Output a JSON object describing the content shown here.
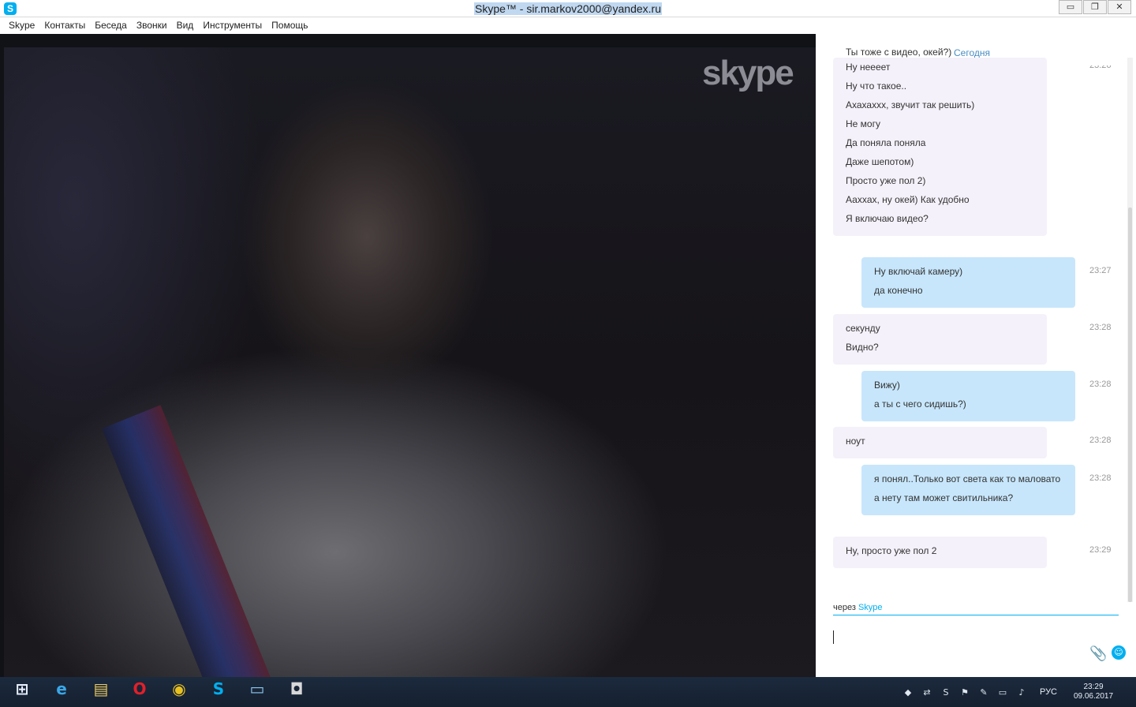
{
  "window": {
    "title": "Skype™ - sir.markov2000@yandex.ru",
    "controls": [
      "▭",
      "❐",
      "✕"
    ]
  },
  "menu": [
    "Skype",
    "Контакты",
    "Беседа",
    "Звонки",
    "Вид",
    "Инструменты",
    "Помощь"
  ],
  "video": {
    "logo_text": "skype"
  },
  "chat": {
    "date_header": "Сегодня",
    "messages": [
      {
        "dir": "in",
        "lines": [
          "Ты тоже с видео, окей?)",
          "Ну неееет",
          "Ну что такое..",
          "Ахахахxx, звучит так решить)",
          "Не могу",
          "Да поняла поняла",
          "Даже шепотом)",
          "Просто уже пол 2)",
          "Аахxах, ну окей) Как удобно",
          "Я включаю видео?"
        ],
        "time": "23:26"
      },
      {
        "dir": "out",
        "lines": [
          "Ну включай камеру)",
          "да конечно"
        ],
        "time": "23:27"
      },
      {
        "dir": "in",
        "lines": [
          "секунду",
          "Видно?"
        ],
        "time": "23:28"
      },
      {
        "dir": "out",
        "lines": [
          "Вижу)",
          "а ты с чего сидишь?)"
        ],
        "time": "23:28"
      },
      {
        "dir": "in",
        "lines": [
          "ноут"
        ],
        "time": "23:28"
      },
      {
        "dir": "out",
        "lines": [
          "я понял..Только вот света как то маловато",
          "а нету там может свитильника?"
        ],
        "time": "23:28"
      },
      {
        "dir": "in",
        "lines": [
          "Ну, просто уже пол 2"
        ],
        "time": "23:29"
      }
    ],
    "via_prefix": "через",
    "via_link": "Skype",
    "input_value": ""
  },
  "taskbar": {
    "apps": [
      {
        "name": "start-button",
        "icon": "windows-logo-icon",
        "glyph": "⊞"
      },
      {
        "name": "taskbar-ie",
        "icon": "internet-explorer-icon",
        "glyph": "e"
      },
      {
        "name": "taskbar-explorer",
        "icon": "folder-icon",
        "glyph": "▤"
      },
      {
        "name": "taskbar-opera",
        "icon": "opera-icon",
        "glyph": "O"
      },
      {
        "name": "taskbar-chrome",
        "icon": "chrome-icon",
        "glyph": "◉"
      },
      {
        "name": "taskbar-skype",
        "icon": "skype-icon",
        "glyph": "S"
      },
      {
        "name": "taskbar-computer",
        "icon": "monitor-icon",
        "glyph": "▭"
      },
      {
        "name": "taskbar-camera",
        "icon": "webcam-icon",
        "glyph": "◘"
      }
    ],
    "language": "РУС",
    "time": "23:29",
    "date": "09.06.2017"
  }
}
